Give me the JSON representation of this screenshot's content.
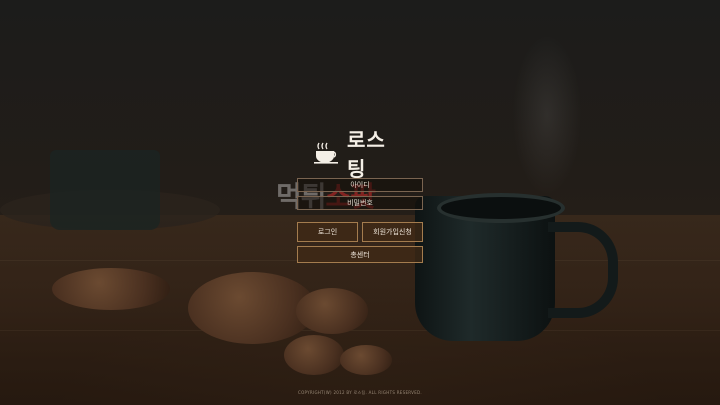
{
  "brand": {
    "name": "로스팅",
    "icon": "coffee-cup-icon"
  },
  "login_form": {
    "id_placeholder": "아이디",
    "password_placeholder": "비밀번호",
    "login_label": "로그인",
    "signup_label": "회원가입신청",
    "contact_label": "총센터"
  },
  "watermark": {
    "part1": "먹튀",
    "part2": "소팟"
  },
  "footer": {
    "copyright": "COPYRIGHT(W) 2012 BY 로스팅. ALL RIGHTS RESERVED."
  },
  "colors": {
    "button_border": "#a47c4e",
    "button_bg": "#402a16",
    "text": "#efe6da"
  }
}
